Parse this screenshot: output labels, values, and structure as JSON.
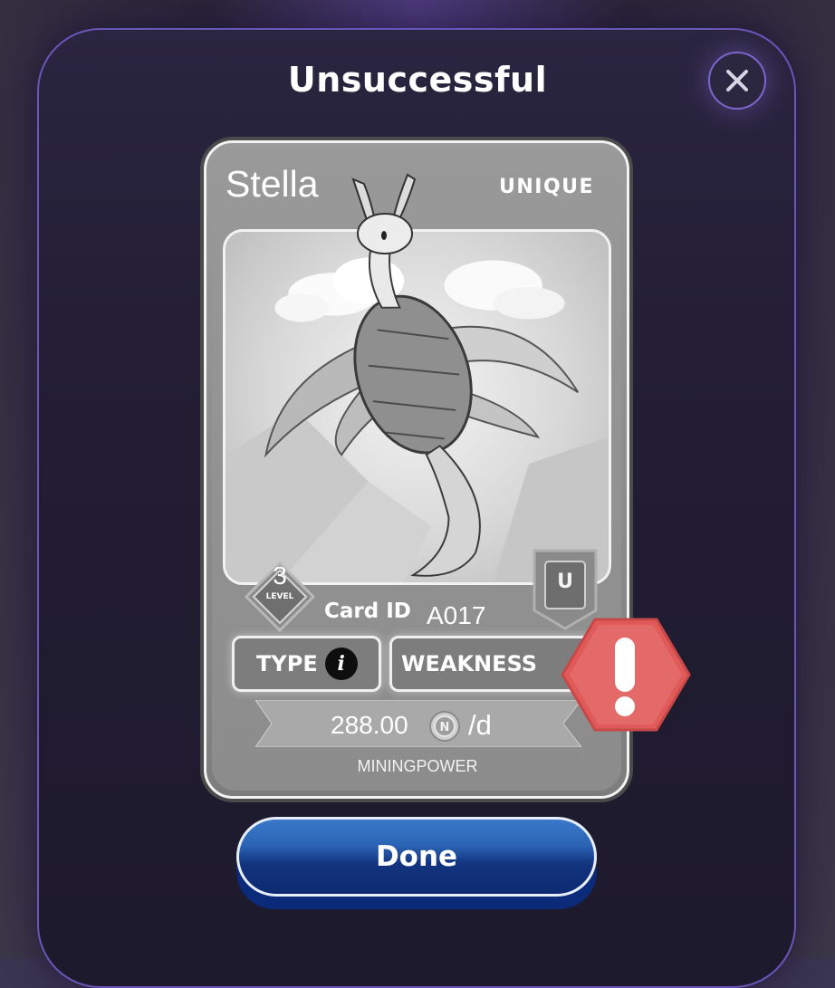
{
  "dialog": {
    "title": "Unsuccessful",
    "close_icon": "close-icon",
    "done_label": "Done"
  },
  "card": {
    "name": "Stella",
    "rarity": "UNIQUE",
    "level": "3",
    "level_label": "LEVEL",
    "card_id_label": "Card ID",
    "card_id": "A017",
    "rarity_badge_letter": "U",
    "type_label": "TYPE",
    "weakness_label": "WEAKNESS",
    "mining_power_value": "288.00",
    "mining_power_unit": "/d",
    "mining_power_label": "MININGPOWER"
  },
  "icons": {
    "info": "info-icon",
    "coin": "coin-icon",
    "alert": "alert-icon"
  },
  "colors": {
    "modal_border": "#6a55b8",
    "alert": "#e05a5a",
    "done_button": "#1e4fa0"
  }
}
